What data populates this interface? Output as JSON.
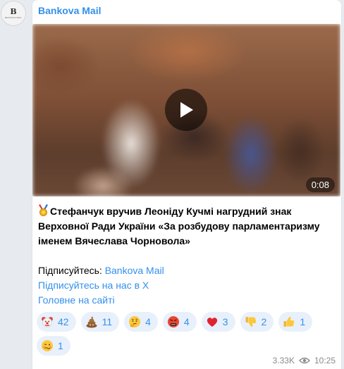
{
  "channel": {
    "name": "Bankova Mail",
    "avatar_letter": "B",
    "avatar_caption": "BANKOVA MAIL"
  },
  "media": {
    "duration": "0:08"
  },
  "post": {
    "headline": "Стефанчук вручив Леоніду Кучмі нагрудний знак Верховної Ради України «За розбудову парламентаризму іменем Вячеслава Чорновола»",
    "subscribe_prefix": "Підписуйтесь: ",
    "subscribe_link": "Bankova Mail",
    "x_link": "Підписуйтесь на нас в Х",
    "site_link": "Головне на сайті"
  },
  "reactions": [
    {
      "icon": "clown-face-icon",
      "count": "42"
    },
    {
      "icon": "pile-of-poo-icon",
      "count": "11"
    },
    {
      "icon": "thinking-face-icon",
      "count": "4"
    },
    {
      "icon": "angry-cursing-face-icon",
      "count": "4"
    },
    {
      "icon": "red-heart-icon",
      "count": "3"
    },
    {
      "icon": "thumbs-down-icon",
      "count": "2"
    },
    {
      "icon": "thumbs-up-icon",
      "count": "1"
    },
    {
      "icon": "woozy-face-icon",
      "count": "1"
    }
  ],
  "meta": {
    "views": "3.33K",
    "time": "10:25"
  },
  "colors": {
    "accent": "#3390ec",
    "chip_bg": "#e8f0fb"
  }
}
